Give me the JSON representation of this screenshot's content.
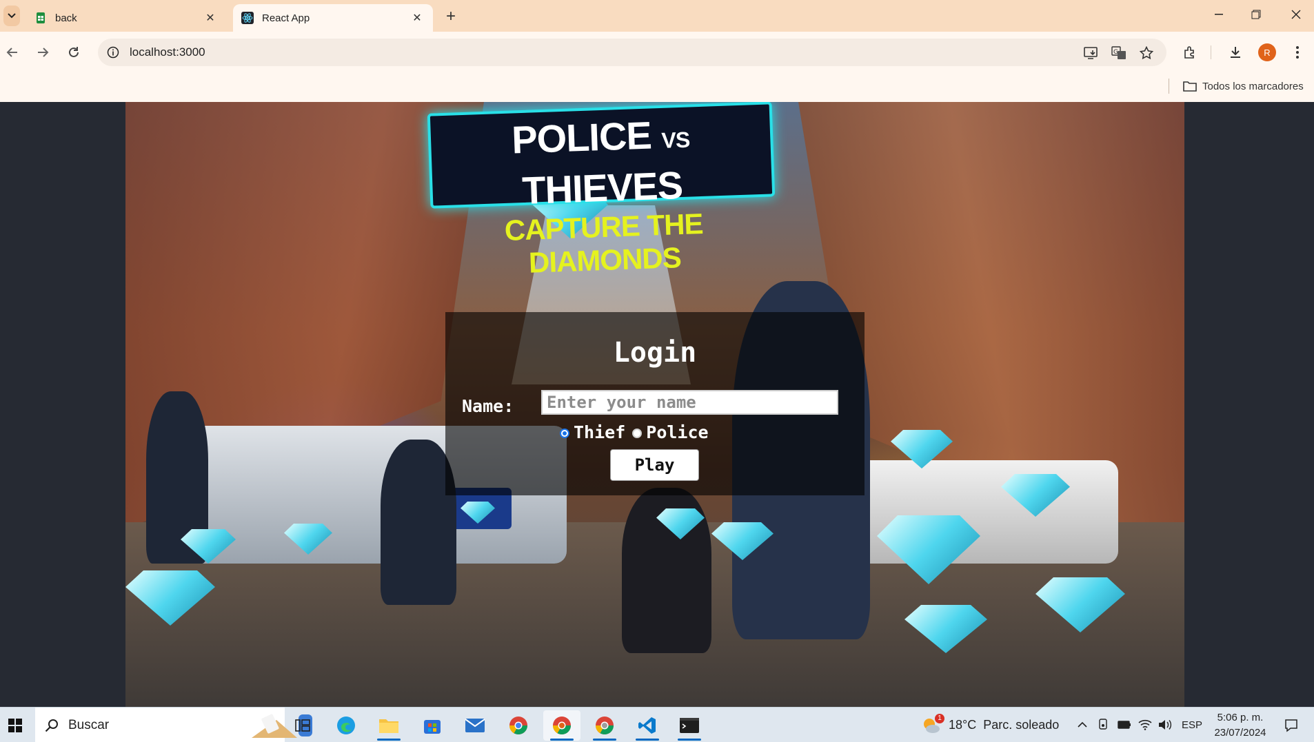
{
  "browser": {
    "tabs": [
      {
        "title": "back",
        "icon": "sheets-icon"
      },
      {
        "title": "React App",
        "icon": "react-icon"
      }
    ],
    "url": "localhost:3000",
    "bookmarks_all": "Todos los marcadores",
    "profile_initial": "R"
  },
  "game": {
    "sign_line1_a": "POLICE",
    "sign_line1_vs": "VS",
    "sign_line1_b": "THIEVES",
    "sign_line2": "CAPTURE THE DIAMONDS"
  },
  "login": {
    "title": "Login",
    "name_label": "Name:",
    "name_value": "",
    "name_placeholder": "Enter your name",
    "roles": [
      {
        "label": "Thief",
        "checked": true
      },
      {
        "label": "Police",
        "checked": false
      }
    ],
    "play_label": "Play"
  },
  "taskbar": {
    "search_placeholder": "Buscar",
    "weather_temp": "18°C",
    "weather_desc": "Parc. soleado",
    "weather_badge": "1",
    "language": "ESP",
    "time": "5:06 p. m.",
    "date": "23/07/2024"
  }
}
